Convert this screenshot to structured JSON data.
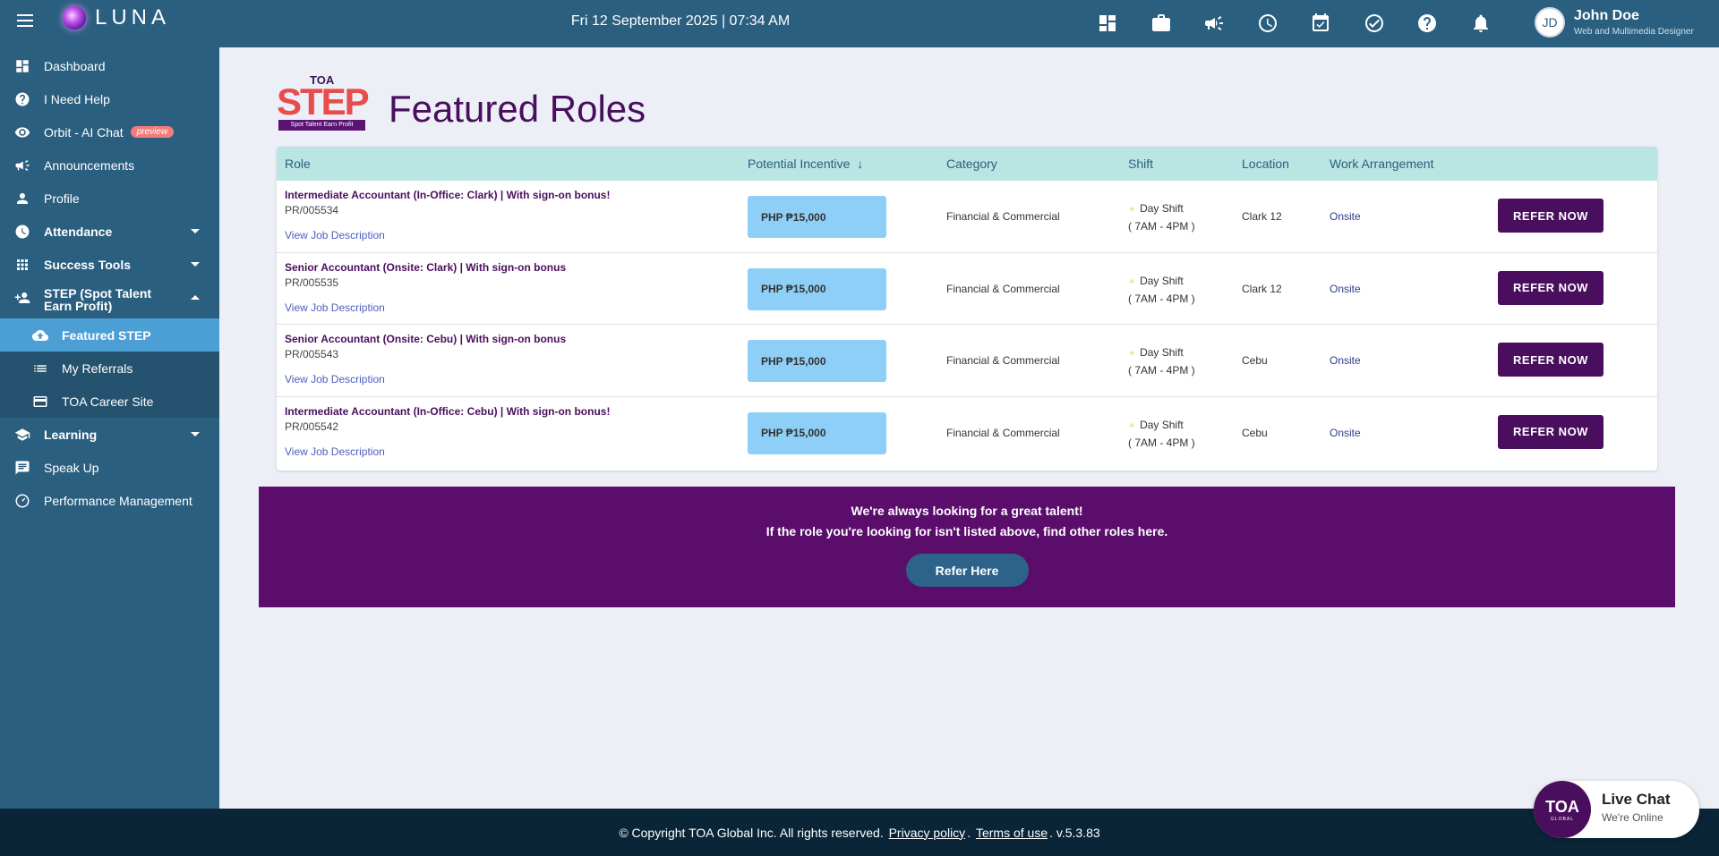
{
  "app": {
    "brand": "LUNA",
    "datetime": "Fri 12 September 2025 | 07:34 AM"
  },
  "user": {
    "initials": "JD",
    "name": "John Doe",
    "role": "Web and Multimedia Designer"
  },
  "topbar_icons": [
    "dashboard-icon",
    "briefcase-icon",
    "megaphone-icon",
    "clock-icon",
    "calendar-check-icon",
    "check-circle-icon",
    "help-icon",
    "bell-icon"
  ],
  "sidebar": {
    "items": [
      {
        "label": "Dashboard",
        "icon": "dashboard-icon"
      },
      {
        "label": "I Need Help",
        "icon": "help-icon"
      },
      {
        "label": "Orbit - AI Chat",
        "icon": "eye-icon",
        "badge": "preview"
      },
      {
        "label": "Announcements",
        "icon": "megaphone-icon"
      },
      {
        "label": "Profile",
        "icon": "person-icon"
      },
      {
        "label": "Attendance",
        "icon": "clock-icon"
      },
      {
        "label": "Success Tools",
        "icon": "grid-icon"
      },
      {
        "label": "STEP (Spot Talent Earn Profit)",
        "icon": "person-add-icon"
      },
      {
        "label": "Featured STEP",
        "icon": "cloud-upload-icon"
      },
      {
        "label": "My Referrals",
        "icon": "list-icon"
      },
      {
        "label": "TOA Career Site",
        "icon": "card-icon"
      },
      {
        "label": "Learning",
        "icon": "school-icon"
      },
      {
        "label": "Speak Up",
        "icon": "chat-icon"
      },
      {
        "label": "Performance Management",
        "icon": "gauge-icon"
      }
    ]
  },
  "logo": {
    "top": "TOA",
    "main": "STEP",
    "tagline": "Spot Talent Earn Profit"
  },
  "page": {
    "title": "Featured Roles"
  },
  "table": {
    "headers": [
      "Role",
      "Potential Incentive",
      "Category",
      "Shift",
      "Location",
      "Work Arrangement"
    ],
    "rows": [
      {
        "title": "Intermediate Accountant (In-Office: Clark) | With sign-on bonus!",
        "code": "PR/005534",
        "link": "View Job Description",
        "incentive": "PHP ₱15,000",
        "category": "Financial & Commercial",
        "shift": "Day Shift",
        "hours": "( 7AM - 4PM )",
        "location": "Clark 12",
        "arrangement": "Onsite",
        "action": "REFER NOW"
      },
      {
        "title": "Senior Accountant (Onsite: Clark) | With sign-on bonus",
        "code": "PR/005535",
        "link": "View Job Description",
        "incentive": "PHP ₱15,000",
        "category": "Financial & Commercial",
        "shift": "Day Shift",
        "hours": "( 7AM - 4PM )",
        "location": "Clark 12",
        "arrangement": "Onsite",
        "action": "REFER NOW"
      },
      {
        "title": "Senior Accountant (Onsite: Cebu) | With sign-on bonus",
        "code": "PR/005543",
        "link": "View Job Description",
        "incentive": "PHP ₱15,000",
        "category": "Financial & Commercial",
        "shift": "Day Shift",
        "hours": "( 7AM - 4PM )",
        "location": "Cebu",
        "arrangement": "Onsite",
        "action": "REFER NOW"
      },
      {
        "title": "Intermediate Accountant (In-Office: Cebu) | With sign-on bonus!",
        "code": "PR/005542",
        "link": "View Job Description",
        "incentive": "PHP ₱15,000",
        "category": "Financial & Commercial",
        "shift": "Day Shift",
        "hours": "( 7AM - 4PM )",
        "location": "Cebu",
        "arrangement": "Onsite",
        "action": "REFER NOW"
      }
    ]
  },
  "banner": {
    "line1": "We're always looking for a great talent!",
    "line2": "If the role you're looking for isn't listed above, find other roles here.",
    "button": "Refer Here"
  },
  "footer": {
    "copyright": "© Copyright TOA Global Inc. All rights reserved.",
    "privacy": "Privacy policy",
    "terms": "Terms of use",
    "version": "v.5.3.83"
  },
  "livechat": {
    "avatar": "TOA",
    "avatar_sub": "GLOBAL",
    "title": "Live Chat",
    "status": "We're Online"
  },
  "colors": {
    "topbar": "#2a5f80",
    "sidebar": "#2b5f80",
    "accent_purple": "#4a0e5e",
    "active_nav": "#4b9fd5",
    "table_header": "#b9e6e2",
    "incentive_bg": "#8ecff7"
  }
}
